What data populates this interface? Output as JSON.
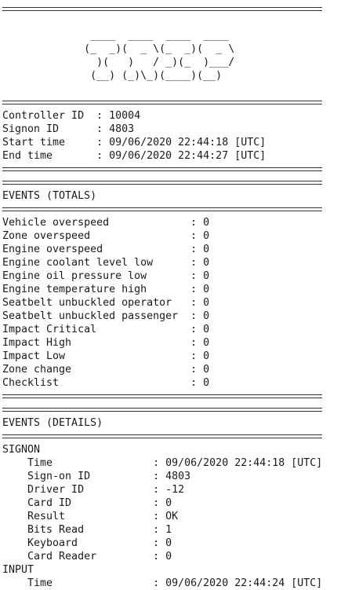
{
  "report": {
    "lines": [
      "==================================================",
      "",
      "              ____  ____  ____  ____",
      "             (_  _)(  _ \\(_  _)(  _ \\",
      "               )(   )   / _)(_  )___/",
      "              (__) (_)\\_)(____)(__)",
      "",
      "==================================================",
      "Controller ID  : 10004",
      "Signon ID      : 4803",
      "Start time     : 09/06/2020 22:44:18 [UTC]",
      "End time       : 09/06/2020 22:44:27 [UTC]",
      "==================================================",
      "==================================================",
      "EVENTS (TOTALS)",
      "==================================================",
      "Vehicle overspeed             : 0",
      "Zone overspeed                : 0",
      "Engine overspeed              : 0",
      "Engine coolant level low      : 0",
      "Engine oil pressure low       : 0",
      "Engine temperature high       : 0",
      "Seatbelt unbuckled operator   : 0",
      "Seatbelt unbuckled passenger  : 0",
      "Impact Critical               : 0",
      "Impact High                   : 0",
      "Impact Low                    : 0",
      "Zone change                   : 0",
      "Checklist                     : 0",
      "==================================================",
      "==================================================",
      "EVENTS (DETAILS)",
      "==================================================",
      "SIGNON",
      "    Time                : 09/06/2020 22:44:18 [UTC]",
      "    Sign-on ID          : 4803",
      "    Driver ID           : -12",
      "    Card ID             : 0",
      "    Result              : OK",
      "    Bits Read           : 1",
      "    Keyboard            : 0",
      "    Card Reader         : 0",
      "INPUT",
      "    Time                : 09/06/2020 22:44:24 [UTC]"
    ]
  }
}
